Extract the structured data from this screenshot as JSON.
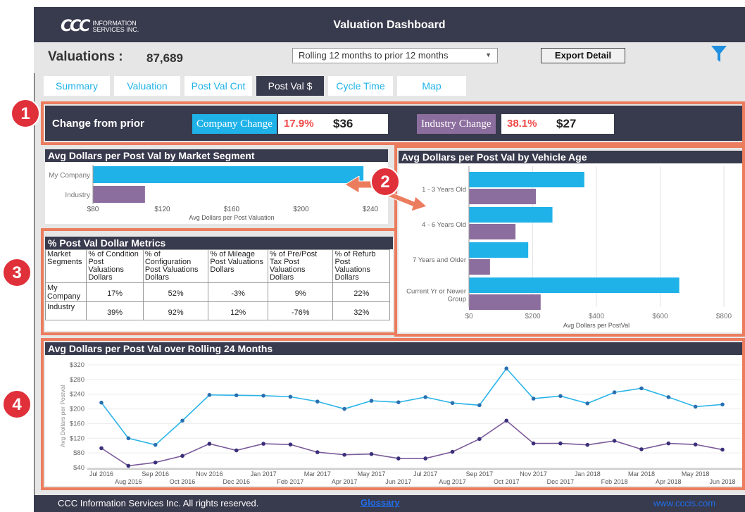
{
  "header": {
    "logo_mark": "CCC",
    "logo_line1": "INFORMATION",
    "logo_line2": "SERVICES INC.",
    "title": "Valuation Dashboard"
  },
  "summary": {
    "label": "Valuations :",
    "count": "87,689",
    "period_select": "Rolling 12 months to prior 12 months",
    "export_label": "Export Detail",
    "filter_icon": "funnel-icon"
  },
  "tabs": [
    {
      "label": "Summary"
    },
    {
      "label": "Valuation"
    },
    {
      "label": "Post Val Cnt"
    },
    {
      "label": "Post Val $",
      "active": true
    },
    {
      "label": "Cycle Time"
    },
    {
      "label": "Map"
    }
  ],
  "badges": [
    "1",
    "2",
    "3",
    "4"
  ],
  "change": {
    "label": "Change from prior",
    "company_label": "Company Change",
    "company_pct": "17.9%",
    "company_value": "$36",
    "industry_label": "Industry Change",
    "industry_pct": "38.1%",
    "industry_value": "$27"
  },
  "colors": {
    "company": "#1fb2e8",
    "industry": "#8c6e9e",
    "dark": "#383a4d",
    "accent": "#ec7c5e",
    "company_line": "#2bb4e8",
    "industry_line": "#7a5a99"
  },
  "segment_chart": {
    "title": "Avg Dollars per Post Val by Market Segment",
    "chart_data": {
      "type": "bar",
      "orientation": "horizontal",
      "categories": [
        "My Company",
        "Industry"
      ],
      "values": [
        236,
        110
      ],
      "xlabel": "Avg Dollars per Post Valuation",
      "xlim": [
        80,
        240
      ],
      "xticks": [
        "$80",
        "$120",
        "$160",
        "$200",
        "$240"
      ]
    }
  },
  "age_chart": {
    "title": "Avg Dollars per Post Val  by Vehicle Age",
    "chart_data": {
      "type": "bar",
      "orientation": "horizontal",
      "categories": [
        "1 - 3 Years Old",
        "4 - 6 Years Old",
        "7 Years and Older",
        "Current Yr or Newer Group"
      ],
      "category_lines": [
        [
          "1 - 3 Years Old"
        ],
        [
          "4 - 6 Years Old"
        ],
        [
          "7 Years and Older"
        ],
        [
          "Current Yr or Newer",
          "Group"
        ]
      ],
      "series": [
        {
          "key": "company",
          "values": [
            362,
            262,
            186,
            660
          ]
        },
        {
          "key": "industry",
          "values": [
            210,
            146,
            66,
            225
          ]
        }
      ],
      "xlabel": "Avg Dollars per PostVal",
      "xlim": [
        0,
        800
      ],
      "xticks": [
        "$0",
        "$200",
        "$400",
        "$600",
        "$800"
      ],
      "grid": "vertical"
    }
  },
  "metrics": {
    "title": "% Post Val Dollar Metrics",
    "headers": [
      [
        "Market",
        "Segments"
      ],
      [
        "% of Condition",
        "Post",
        "Valuations",
        "Dollars"
      ],
      [
        "% of",
        "Configuration",
        "Post Valuations",
        "Dollars"
      ],
      [
        "% of Mileage",
        "Post Valuations",
        "Dollars"
      ],
      [
        "% of Pre/Post",
        "Tax Post",
        "Valuations",
        "Dollars"
      ],
      [
        "% of Refurb",
        "Post",
        "Valuations",
        "Dollars"
      ]
    ],
    "rows": [
      {
        "segment": [
          "My",
          "Company"
        ],
        "values": [
          "17%",
          "52%",
          "-3%",
          "9%",
          "22%"
        ]
      },
      {
        "segment": [
          "Industry"
        ],
        "values": [
          "39%",
          "92%",
          "12%",
          "-76%",
          "32%"
        ]
      }
    ]
  },
  "trend_chart": {
    "title": "Avg Dollars per Post Val over Rolling 24 Months",
    "chart_data": {
      "type": "line",
      "x": [
        "Jul 2016",
        "Aug 2016",
        "Sep 2016",
        "Oct 2016",
        "Nov 2016",
        "Dec 2016",
        "Jan 2017",
        "Feb 2017",
        "Mar 2017",
        "Apr 2017",
        "May 2017",
        "Jun 2017",
        "Jul 2017",
        "Aug 2017",
        "Sep 2017",
        "Oct 2017",
        "Nov 2017",
        "Dec 2017",
        "Jan 2018",
        "Feb 2018",
        "Mar 2018",
        "Apr 2018",
        "May 2018",
        "Jun 2018"
      ],
      "series": [
        {
          "key": "company",
          "values": [
            217,
            120,
            102,
            168,
            238,
            237,
            236,
            233,
            220,
            200,
            222,
            218,
            232,
            216,
            210,
            310,
            228,
            235,
            215,
            245,
            256,
            232,
            206,
            212
          ]
        },
        {
          "key": "industry",
          "values": [
            93,
            45,
            54,
            72,
            105,
            87,
            105,
            103,
            82,
            75,
            77,
            65,
            65,
            83,
            118,
            168,
            106,
            106,
            102,
            113,
            90,
            106,
            103,
            89
          ]
        }
      ],
      "ylabel": "Avg Dollars per Postval",
      "ylim": [
        40,
        320
      ],
      "yticks": [
        "$320",
        "$280",
        "$240",
        "$200",
        "$160",
        "$120",
        "$80",
        "$40"
      ],
      "grid": "horizontal"
    }
  },
  "footer": {
    "copyright": "CCC Information Services Inc. All rights reserved.",
    "glossary": "Glossary",
    "website": "www.cccis.com"
  }
}
